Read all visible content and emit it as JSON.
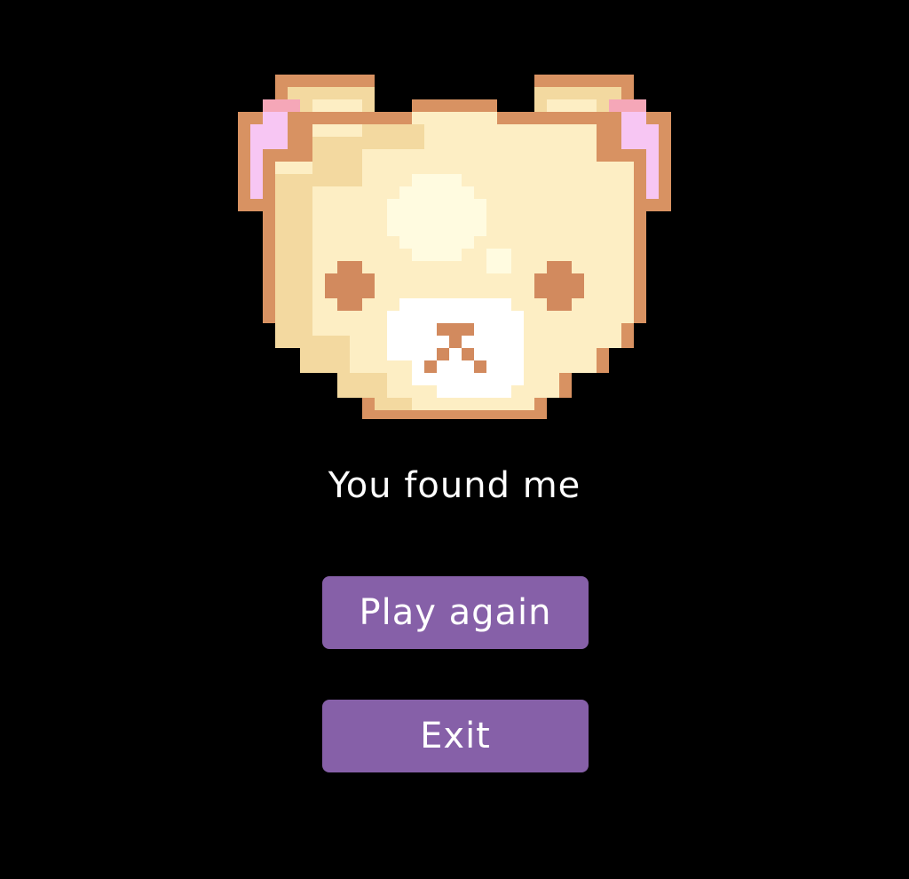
{
  "colors": {
    "background": "#000000",
    "text": "#ffffff",
    "button": "#8660a8",
    "bear_outline": "#d89262",
    "bear_fur": "#fdeec4",
    "bear_fur_shade": "#f3d9a0",
    "bear_highlight": "#fffbe0",
    "bear_ear_inner": "#f7c6f3",
    "bear_ear_pink": "#f5a7b8",
    "bear_muzzle": "#ffffff",
    "bear_features": "#d28a5e"
  },
  "image": {
    "icon": "pixel-bear-face-icon"
  },
  "message": "You found me",
  "buttons": {
    "play_again": "Play again",
    "exit": "Exit"
  }
}
